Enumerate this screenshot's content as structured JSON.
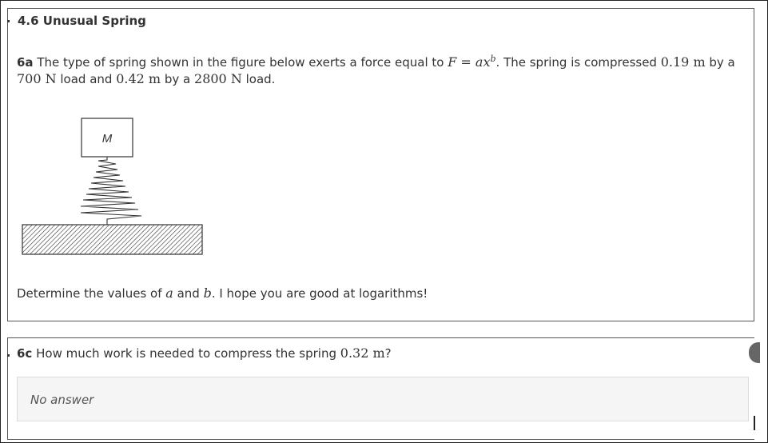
{
  "section": {
    "title": "4.6 Unusual Spring"
  },
  "q6a": {
    "tag": "6a",
    "line1_pre": " The type of spring shown in the figure below exerts a force equal to ",
    "formula": "F = ax",
    "formula_exp": "b",
    "line1_mid": ". The spring is compressed ",
    "val1": "0.19 m",
    "line1_post": " by a",
    "val2": "700 N",
    "line2_a": " load and ",
    "val3": "0.42 m",
    "line2_b": " by a ",
    "val4": "2800 N",
    "line2_c": " load.",
    "figure_label": "M",
    "prompt_pre": "Determine the values of ",
    "var_a": "a",
    "prompt_and": " and ",
    "var_b": "b",
    "prompt_post": ". I hope you are good at logarithms!"
  },
  "q6c": {
    "tag": "6c",
    "text_pre": " How much work is needed to compress the spring ",
    "val": "0.32 m",
    "text_post": "?",
    "answer_placeholder": "No answer"
  }
}
